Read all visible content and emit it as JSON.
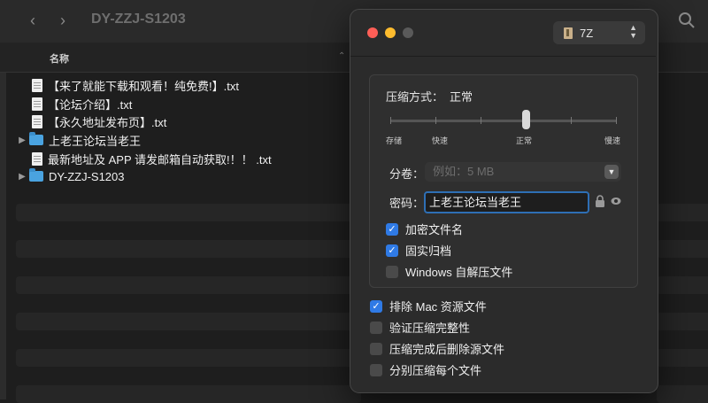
{
  "window": {
    "title": "DY-ZZJ-S1203"
  },
  "columns": {
    "name": "名称"
  },
  "files": [
    {
      "name": "【来了就能下载和观看！纯免费!】.txt",
      "kind": "file"
    },
    {
      "name": "【论坛介绍】.txt",
      "kind": "file"
    },
    {
      "name": "【永久地址发布页】.txt",
      "kind": "file"
    },
    {
      "name": "上老王论坛当老王",
      "kind": "folder"
    },
    {
      "name": "最新地址及 APP 请发邮箱自动获取!！！ .txt",
      "kind": "file"
    },
    {
      "name": "DY-ZZJ-S1203",
      "kind": "folder"
    }
  ],
  "archive": {
    "format": "7Z",
    "compression_label": "压缩方式：",
    "compression_value": "正常",
    "compression_level": 3,
    "levels": [
      "存储",
      "快速",
      "正常",
      "慢速"
    ],
    "split_label": "分卷：",
    "split_placeholder": "例如：5 MB",
    "password_label": "密码：",
    "password_value": "上老王论坛当老王",
    "encrypt_filenames": {
      "label": "加密文件名",
      "checked": true
    },
    "solid_archive": {
      "label": "固实归档",
      "checked": true
    },
    "windows_sfx": {
      "label": "Windows 自解压文件",
      "checked": false
    },
    "exclude_mac": {
      "label": "排除 Mac 资源文件",
      "checked": true
    },
    "verify": {
      "label": "验证压缩完整性",
      "checked": false
    },
    "delete_after": {
      "label": "压缩完成后删除源文件",
      "checked": false
    },
    "separate": {
      "label": "分别压缩每个文件",
      "checked": false
    }
  },
  "colors": {
    "accent": "#2f7ae5",
    "folder": "#4aa3e0"
  }
}
